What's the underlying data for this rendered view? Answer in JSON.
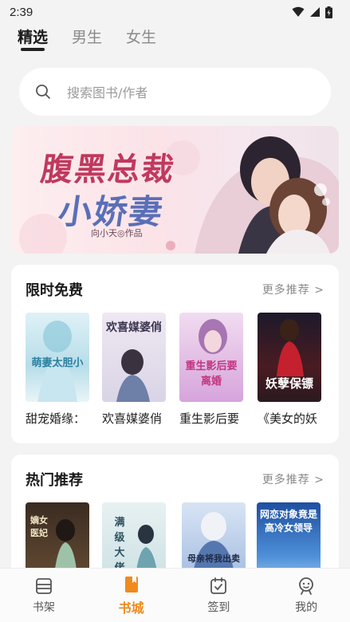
{
  "status": {
    "time": "2:39"
  },
  "top_tabs": [
    {
      "label": "精选"
    },
    {
      "label": "男生"
    },
    {
      "label": "女生"
    }
  ],
  "search": {
    "placeholder": "搜索图书/作者"
  },
  "banner": {
    "title_line1": "腹黑总裁",
    "title_line2": "小娇妻",
    "author": "向小天◎作品"
  },
  "limited_free": {
    "title": "限时免费",
    "more": "更多推荐 >",
    "books": [
      {
        "title": "甜宠婚缘：",
        "cover_text": "萌妻太胆小"
      },
      {
        "title": "欢喜媒婆俏",
        "cover_text": "欢喜媒婆俏"
      },
      {
        "title": "重生影后要",
        "cover_text": "重生影后要离婚"
      },
      {
        "title": "《美女的妖",
        "cover_text": "妖孽保镖"
      }
    ]
  },
  "hot": {
    "title": "热门推荐",
    "more": "更多推荐 >",
    "books": [
      {
        "cover_text": "嫡女医妃"
      },
      {
        "cover_text": "满级大佬"
      },
      {
        "cover_text": "母亲将我出卖"
      },
      {
        "cover_text": "网恋对象竟是高冷女领导"
      }
    ]
  },
  "bottom_nav": [
    {
      "label": "书架"
    },
    {
      "label": "书城"
    },
    {
      "label": "签到"
    },
    {
      "label": "我的"
    }
  ],
  "colors": {
    "accent": "#f08a1c",
    "background": "#f3f3f3"
  }
}
